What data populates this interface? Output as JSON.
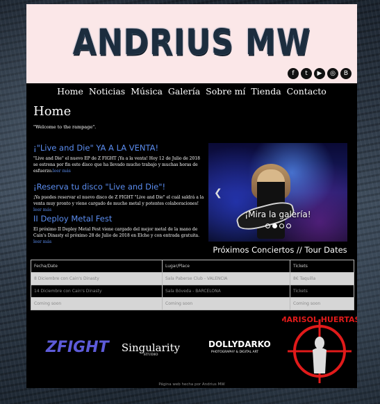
{
  "site": {
    "logo_text": "ANDRIUS MW",
    "social_icons": [
      "facebook-icon",
      "twitter-icon",
      "youtube-icon",
      "instagram-icon",
      "blogger-icon"
    ]
  },
  "nav": {
    "items": [
      "Home",
      "Noticias",
      "Música",
      "Galería",
      "Sobre mí",
      "Tienda",
      "Contacto"
    ]
  },
  "main": {
    "title": "Home",
    "welcome": "\"Welcome to the rampage\"."
  },
  "news": [
    {
      "title": "¡\"Live and Die\" YA A LA VENTA!",
      "text": "\"Live and Die\" el nuevo EP de Z FIGHT ¡Ya a la venta! Hoy 12 de Julio de 2018 se estrena por fin este disco que ha llevado mucho trabajo y muchas horas de esfuerzo.",
      "link": "leer más"
    },
    {
      "title": "¡Reserva tu disco \"Live and Die\"!",
      "text": "¡Ya puedes reservar el nuevo disco de Z FIGHT \"Live and Die\" el cuál saldrá a la venta muy pronto y viene cargado de mucho metal y potentes colaboraciones!",
      "link": "leer más"
    },
    {
      "title": "II Deploy Metal Fest",
      "text": "El próximo II Deploy Metal Fest viene cargado del mejor metal de la mano de Cain's Dinasty el próximo 28 de Julio de 2018 en Elche y con entrada gratuita.",
      "link": "leer más"
    }
  ],
  "carousel": {
    "caption": "¡Mira la galería!",
    "prev_symbol": "❮",
    "slides": 4,
    "active": 2
  },
  "tour": {
    "title": "Próximos Conciertos // Tour Dates",
    "headers": [
      "Fecha/Date",
      "Lugar/Place",
      "Tickets"
    ],
    "rows": [
      [
        "8 Diciembre con Cain's Dinasty",
        "Sala Paberse Club - VALENCIA",
        "8€ Taquilla"
      ],
      [
        "14 Diciembre con Cain's Dinasty",
        "Sala Bóveda - BARCELONA",
        "Tickets"
      ],
      [
        "Coming soon",
        "Coming soon",
        "Coming soon"
      ]
    ]
  },
  "partners": {
    "zfight": "ZFIGHT",
    "singularity": "Singularity",
    "singularity_sub": "STUDIO",
    "dollydarko": "DOLLYDARKO",
    "dollydarko_sub": "PHOTOGRAPHY & DIGITAL ART",
    "marisol": "MARISOL HUERTAS"
  },
  "footer": "Página web hecha por Andrius MW"
}
